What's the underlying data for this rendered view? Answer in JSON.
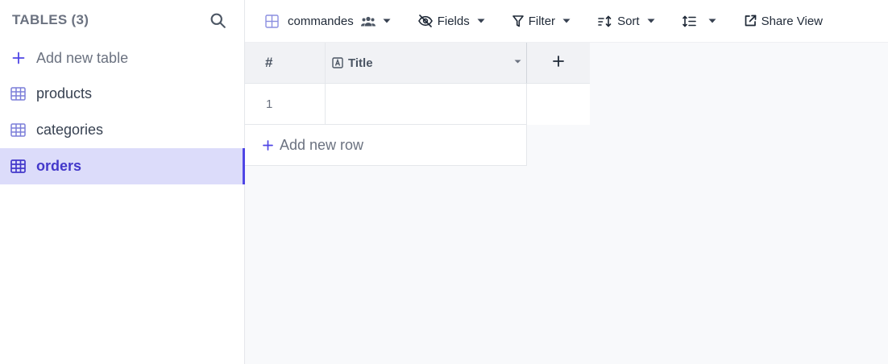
{
  "sidebar": {
    "title": "TABLES (3)",
    "add_table_label": "Add new table",
    "tables": [
      {
        "label": "products",
        "active": false
      },
      {
        "label": "categories",
        "active": false
      },
      {
        "label": "orders",
        "active": true
      }
    ]
  },
  "toolbar": {
    "view_name": "commandes",
    "fields_label": "Fields",
    "filter_label": "Filter",
    "sort_label": "Sort",
    "share_label": "Share View"
  },
  "grid": {
    "row_number_header": "#",
    "columns": [
      {
        "label": "Title",
        "type_icon": "text-type-icon"
      }
    ],
    "rows": [
      {
        "number": "1",
        "title": ""
      }
    ],
    "add_row_label": "Add new row"
  },
  "colors": {
    "accent": "#4f46e5",
    "active_bg": "#dcdcfa",
    "table_icon": "#7c7fd9"
  }
}
